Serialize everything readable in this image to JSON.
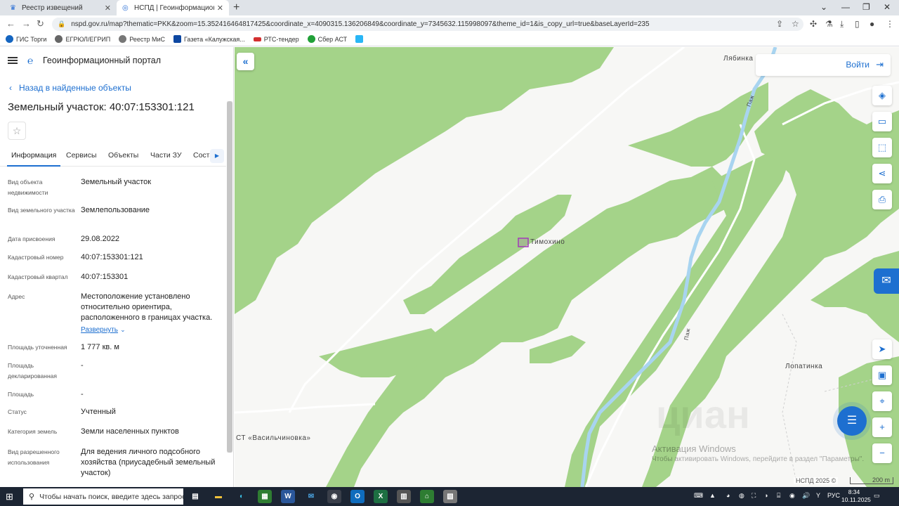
{
  "browser": {
    "tabs": [
      {
        "title": "Реестр извещений",
        "active": false
      },
      {
        "title": "НСПД | Геоинформационный п",
        "active": true
      }
    ],
    "url": "nspd.gov.ru/map?thematic=PKK&zoom=15.352416464817425&coordinate_x=4090315.136206849&coordinate_y=7345632.115998097&theme_id=1&is_copy_url=true&baseLayerId=235",
    "bookmarks": [
      "ГИС Торги",
      "ЕГРЮЛ/ЕГРИП",
      "Реестр МиС",
      "Газета «Калужская...",
      "РТС-тендер",
      "Сбер АСТ"
    ]
  },
  "panel": {
    "portal_title": "Геоинформационный портал",
    "back_label": "Назад в найденные объекты",
    "object_title": "Земельный участок: 40:07:153301:121",
    "tabs": [
      "Информация",
      "Сервисы",
      "Объекты",
      "Части ЗУ",
      "Соста"
    ],
    "fields": [
      {
        "label": "Вид объекта недвижимости",
        "value": "Земельный участок"
      },
      {
        "label": "Вид земельного участка",
        "value": "Землепользование"
      },
      {
        "label": "Дата присвоения",
        "value": "29.08.2022"
      },
      {
        "label": "Кадастровый номер",
        "value": "40:07:153301:121"
      },
      {
        "label": "Кадастровый квартал",
        "value": "40:07:153301"
      },
      {
        "label": "Адрес",
        "value": "Местоположение установлено относительно ориентира, расположенного в границах участка."
      },
      {
        "label": "Площадь уточненная",
        "value": "1 777 кв. м"
      },
      {
        "label": "Площадь декларированная",
        "value": "-"
      },
      {
        "label": "Площадь",
        "value": "-"
      },
      {
        "label": "Статус",
        "value": "Учтенный"
      },
      {
        "label": "Категория земель",
        "value": "Земли населенных пунктов"
      },
      {
        "label": "Вид разрешенного использования",
        "value": "Для ведения личного подсобного хозяйства (приусадебный земельный участок)"
      }
    ],
    "expand_label": "Развернуть"
  },
  "map": {
    "labels": {
      "lyabinka": "Лябинка",
      "timokhino": "Тимохино",
      "lopatinka": "Лопатинка",
      "vasilchinovka": "СТ «Васильчиновка»",
      "paj1": "Паж",
      "paj2": "Паж"
    },
    "login_label": "Войти",
    "attribution": "НСПД 2025 ©",
    "scale_label": "200 m",
    "watermark": "циан",
    "activation_title": "Активация Windows",
    "activation_text": "Чтобы активировать Windows, перейдите в раздел \"Параметры\".",
    "colors": {
      "forest": "#a4d389",
      "river": "#a8d4f0",
      "road": "#ffffff",
      "parcel": "#a23bb8",
      "accent": "#1d6fd0"
    }
  },
  "taskbar": {
    "search_placeholder": "Чтобы начать поиск, введите здесь запрос",
    "lang": "РУС",
    "time": "8:34",
    "date": "10.11.2025"
  }
}
